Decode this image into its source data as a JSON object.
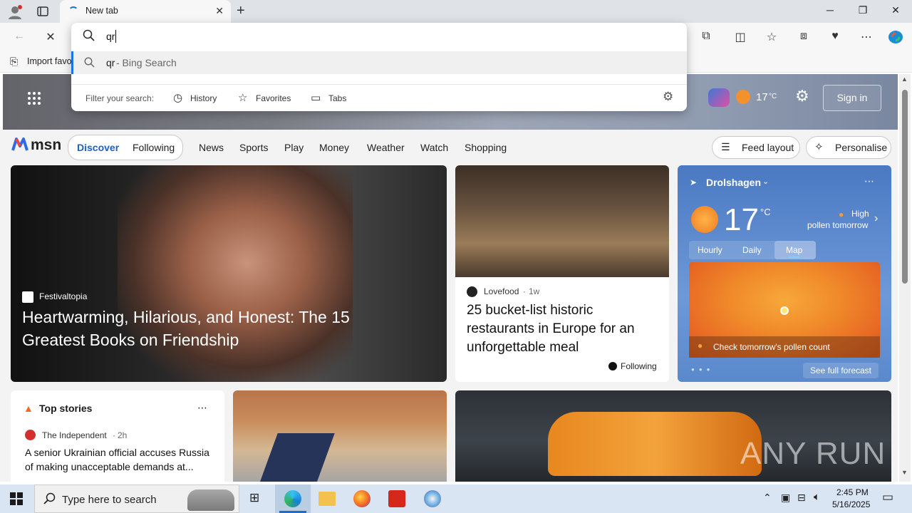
{
  "browser": {
    "tab_title": "New tab",
    "favorites_item": "Import favo",
    "address_value": "qr"
  },
  "omnibox": {
    "suggestion_query": "qr",
    "suggestion_suffix": " - Bing Search",
    "filter_label": "Filter your search:",
    "filters": [
      "History",
      "Favorites",
      "Tabs"
    ]
  },
  "msn_header": {
    "temperature": "17",
    "temp_unit": "°C",
    "sign_in": "Sign in"
  },
  "msn_nav": {
    "logo": "msn",
    "toggle": [
      "Discover",
      "Following"
    ],
    "links": [
      "News",
      "Sports",
      "Play",
      "Money",
      "Weather",
      "Watch",
      "Shopping"
    ],
    "feed_layout": "Feed layout",
    "personalise": "Personalise"
  },
  "hero": {
    "source": "Festivaltopia",
    "title": "Heartwarming, Hilarious, and Honest: The 15 Greatest Books on Friendship"
  },
  "article2": {
    "source": "Lovefood",
    "age": "1w",
    "title": "25 bucket-list historic restaurants in Europe for an unforgettable meal",
    "following": "Following"
  },
  "weather": {
    "location": "Drolshagen",
    "temp": "17",
    "unit": "°C",
    "pollen_level": "High",
    "pollen_when": "pollen tomorrow",
    "tabs": [
      "Hourly",
      "Daily",
      "Map"
    ],
    "active_tab": "Map",
    "pollen_link": "Check tomorrow's pollen count",
    "full_forecast": "See full forecast"
  },
  "top_stories": {
    "title": "Top stories",
    "source": "The Independent",
    "age": "2h",
    "headline": "A senior Ukrainian official accuses Russia of making unacceptable demands at..."
  },
  "watermark": "ANY RUN",
  "taskbar": {
    "search_placeholder": "Type here to search",
    "time": "2:45 PM",
    "date": "5/16/2025"
  },
  "colors": {
    "accent": "#1a73e8",
    "taskbar": "#d9e5f3",
    "weather_card": "#4d7fc9"
  }
}
